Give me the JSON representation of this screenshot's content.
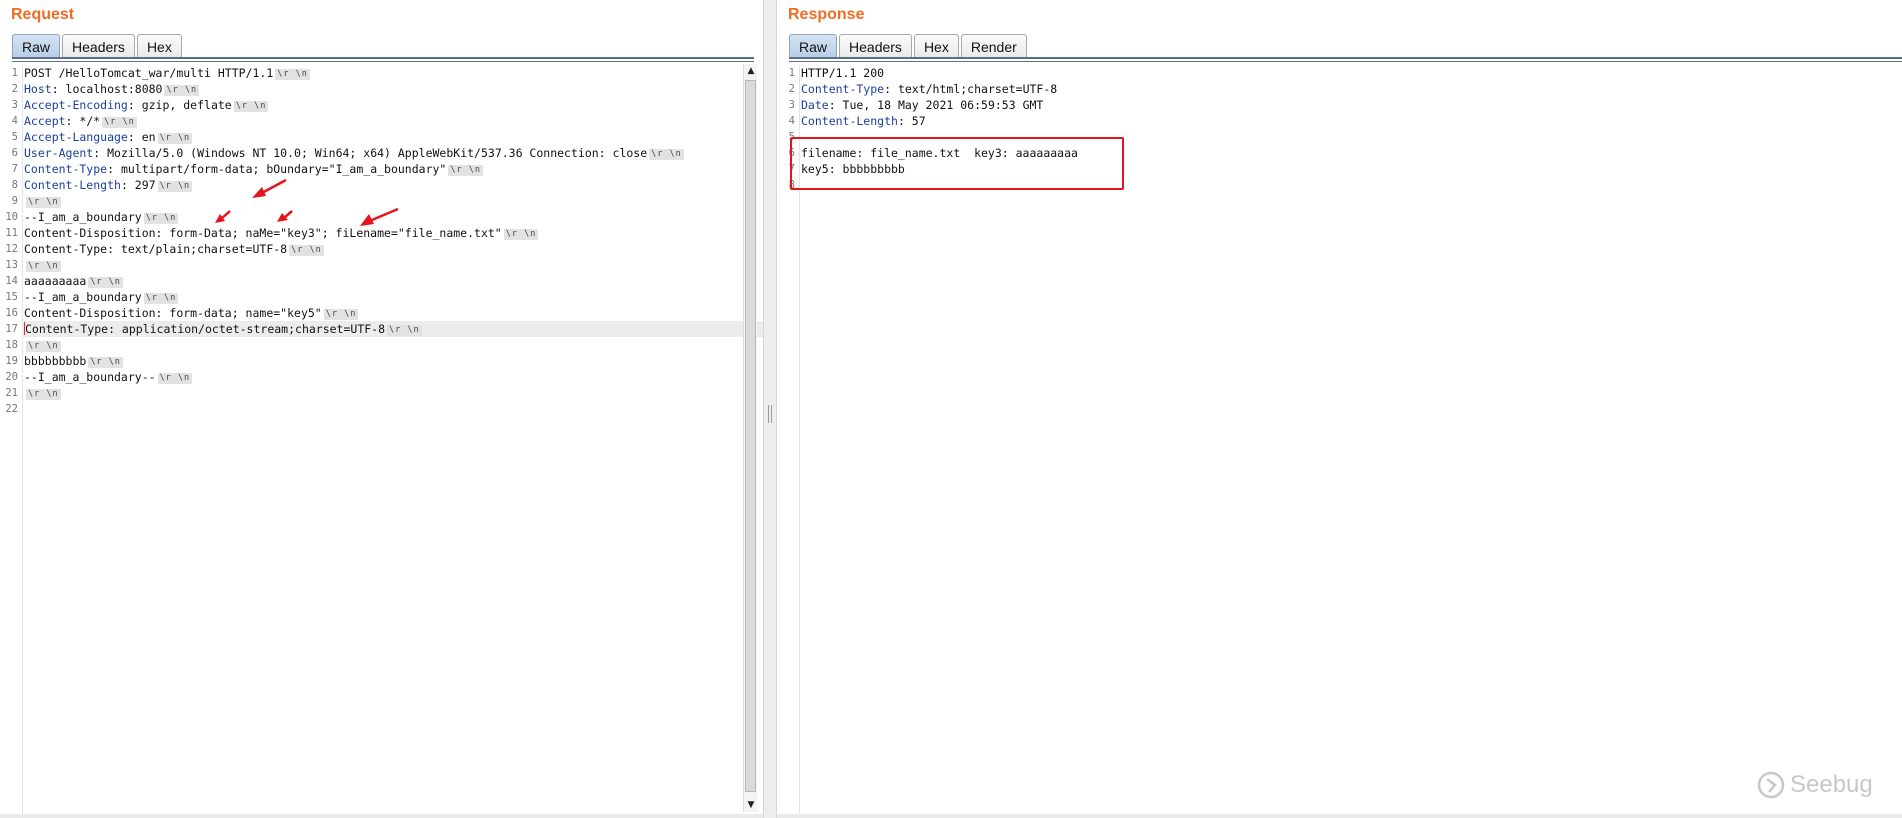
{
  "request": {
    "title": "Request",
    "tabs": [
      "Raw",
      "Headers",
      "Hex"
    ],
    "active_tab": "Raw",
    "crlf_label": "\\r \\n",
    "lines": [
      {
        "num": "1",
        "header": "",
        "text": "POST /HelloTomcat_war/multi HTTP/1.1",
        "crlf": true
      },
      {
        "num": "2",
        "header": "Host",
        "text": ": localhost:8080",
        "crlf": true
      },
      {
        "num": "3",
        "header": "Accept-Encoding",
        "text": ": gzip, deflate",
        "crlf": true
      },
      {
        "num": "4",
        "header": "Accept",
        "text": ": */*",
        "crlf": true
      },
      {
        "num": "5",
        "header": "Accept-Language",
        "text": ": en",
        "crlf": true
      },
      {
        "num": "6",
        "header": "User-Agent",
        "text": ": Mozilla/5.0 (Windows NT 10.0; Win64; x64) AppleWebKit/537.36 Connection: close",
        "crlf": true
      },
      {
        "num": "7",
        "header": "Content-Type",
        "text": ": multipart/form-data; bOundary=\"I_am_a_boundary\"",
        "crlf": true
      },
      {
        "num": "8",
        "header": "Content-Length",
        "text": ": 297",
        "crlf": true
      },
      {
        "num": "9",
        "header": "",
        "text": "",
        "crlf": true
      },
      {
        "num": "10",
        "header": "",
        "text": "--I_am_a_boundary",
        "crlf": true
      },
      {
        "num": "11",
        "header": "",
        "text": "Content-Disposition: form-Data; naMe=\"key3\"; fiLename=\"file_name.txt\"",
        "crlf": true
      },
      {
        "num": "12",
        "header": "",
        "text": "Content-Type: text/plain;charset=UTF-8",
        "crlf": true
      },
      {
        "num": "13",
        "header": "",
        "text": "",
        "crlf": true
      },
      {
        "num": "14",
        "header": "",
        "text": "aaaaaaaaa",
        "crlf": true
      },
      {
        "num": "15",
        "header": "",
        "text": "--I_am_a_boundary",
        "crlf": true
      },
      {
        "num": "16",
        "header": "",
        "text": "Content-Disposition: form-data; name=\"key5\"",
        "crlf": true
      },
      {
        "num": "17",
        "header": "",
        "text": "Content-Type: application/octet-stream;charset=UTF-8",
        "crlf": true
      },
      {
        "num": "18",
        "header": "",
        "text": "",
        "crlf": true
      },
      {
        "num": "19",
        "header": "",
        "text": "bbbbbbbbb",
        "crlf": true
      },
      {
        "num": "20",
        "header": "",
        "text": "--I_am_a_boundary--",
        "crlf": true
      },
      {
        "num": "21",
        "header": "",
        "text": "",
        "crlf": true
      },
      {
        "num": "22",
        "header": "",
        "text": "",
        "crlf": false
      }
    ]
  },
  "response": {
    "title": "Response",
    "tabs": [
      "Raw",
      "Headers",
      "Hex",
      "Render"
    ],
    "active_tab": "Raw",
    "lines": [
      {
        "num": "1",
        "header": "",
        "text": "HTTP/1.1 200"
      },
      {
        "num": "2",
        "header": "Content-Type",
        "text": ": text/html;charset=UTF-8"
      },
      {
        "num": "3",
        "header": "Date",
        "text": ": Tue, 18 May 2021 06:59:53 GMT"
      },
      {
        "num": "4",
        "header": "Content-Length",
        "text": ": 57"
      },
      {
        "num": "5",
        "header": "",
        "text": ""
      },
      {
        "num": "6",
        "header": "",
        "text": "filename: file_name.txt  key3: aaaaaaaaa"
      },
      {
        "num": "7",
        "header": "",
        "text": "key5: bbbbbbbbb"
      },
      {
        "num": "8",
        "header": "",
        "text": ""
      }
    ]
  },
  "watermark": {
    "text": "Seebug",
    "icon": "seebug-logo-icon"
  },
  "colors": {
    "title_orange": "#f26b21",
    "header_blue": "#1b3f9e",
    "annotation_red": "#e5131b",
    "active_tab": "#b7cde6"
  },
  "scroll": {
    "request_vertical_visible": 1.0
  }
}
